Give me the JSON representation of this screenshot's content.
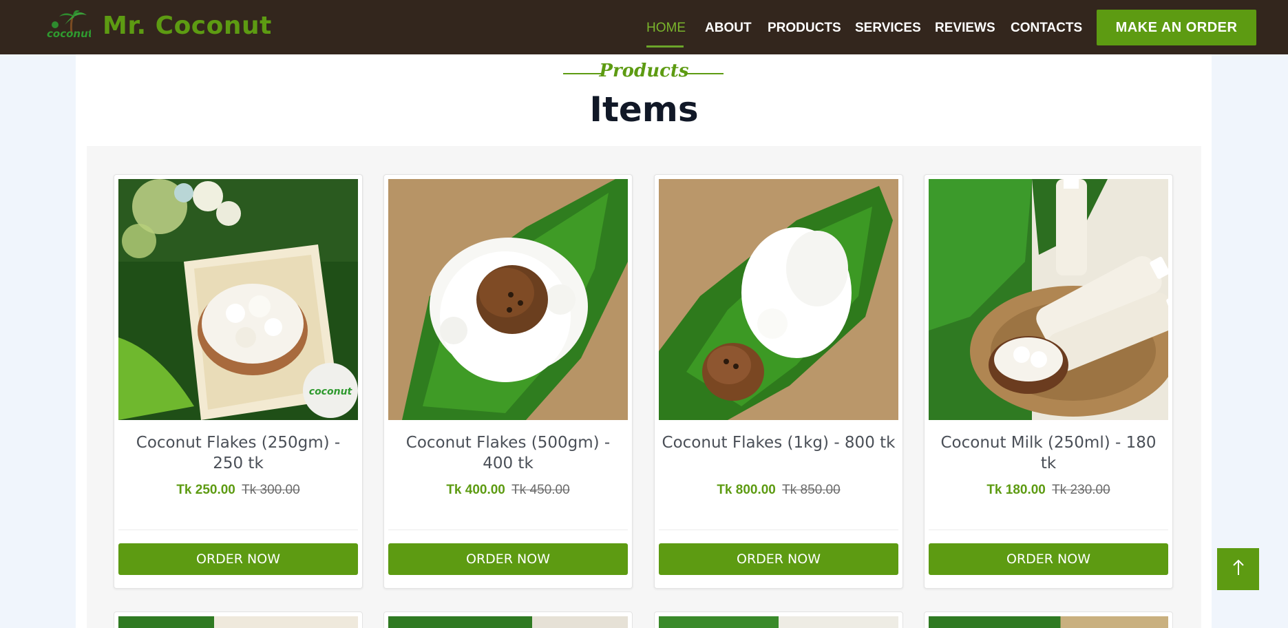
{
  "brand": {
    "name": "Mr. Coconut",
    "logo_text": "coconut"
  },
  "nav": {
    "items": [
      {
        "label": "HOME",
        "active": true
      },
      {
        "label": "ABOUT"
      },
      {
        "label": "PRODUCTS"
      },
      {
        "label": "SERVICES"
      },
      {
        "label": "REVIEWS"
      },
      {
        "label": "CONTACTS"
      }
    ],
    "cta_label": "MAKE AN ORDER"
  },
  "section": {
    "tag": "Products",
    "title": "Items"
  },
  "products": [
    {
      "title": "Coconut Flakes (250gm) - 250 tk",
      "price": "Tk 250.00",
      "old_price": "Tk 300.00",
      "button": "ORDER NOW",
      "image": "coconut-flakes-bowl-image"
    },
    {
      "title": "Coconut Flakes (500gm) - 400 tk",
      "price": "Tk 400.00",
      "old_price": "Tk 450.00",
      "button": "ORDER NOW",
      "image": "coconut-flakes-leaf-image"
    },
    {
      "title": "Coconut Flakes (1kg) - 800 tk",
      "price": "Tk 800.00",
      "old_price": "Tk 850.00",
      "button": "ORDER NOW",
      "image": "coconut-flakes-leaf-image"
    },
    {
      "title": "Coconut Milk (250ml) - 180 tk",
      "price": "Tk 180.00",
      "old_price": "Tk 230.00",
      "button": "ORDER NOW",
      "image": "coconut-milk-bottles-image"
    }
  ],
  "colors": {
    "header_bg": "#33261d",
    "accent": "#5d9b12",
    "page_bg": "#f0f5fc"
  },
  "scroll_top_icon": "arrow-up-icon"
}
